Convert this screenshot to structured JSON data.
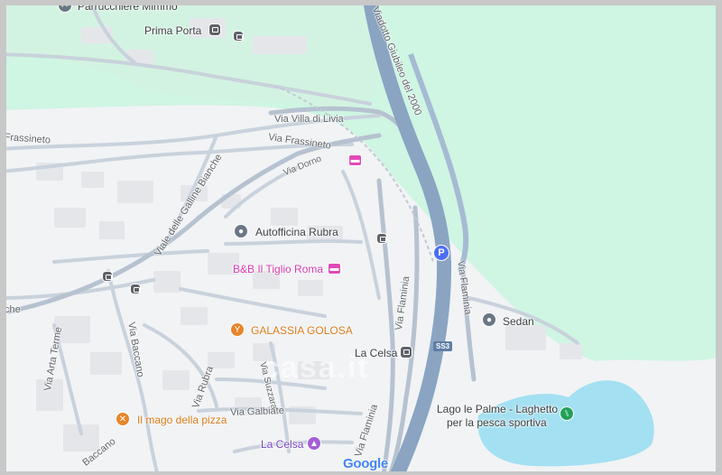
{
  "map": {
    "streets": {
      "viadotto": "Viadotto Giubileo del 2000",
      "villa_di_livia": "Via Villa di Livia",
      "frassineto": "Via Frassineto",
      "frassineto_left": "Frassineto",
      "dorno": "Via Dorno",
      "galline_bianche": "Viale delle Galline Bianche",
      "flaminia_upper": "Via Flaminia",
      "flaminia_right": "Via Flaminia",
      "flaminia_lower": "Via Flaminia",
      "baccano_upper": "Via Baccano",
      "baccano_lower": "Baccano",
      "arta_terme": "Via Arta Terme",
      "rubra": "Via Rubra",
      "suzzara": "Via Suzzara",
      "galbiate": "Via Galbiate",
      "che": "che"
    },
    "places": {
      "parrucchiere": "Parrucchiere Mimmo",
      "prima_porta": "Prima Porta",
      "autofficina": "Autofficina Rubra",
      "bnb": "B&B Il Tiglio Roma",
      "galassia": "GALASSIA GOLOSA",
      "la_celsa_station": "La Celsa",
      "sedan": "Sedan",
      "lago_line1": "Lago le Palme - Laghetto",
      "lago_line2": "per la pesca sportiva",
      "mago_pizza": "Il mago della pizza",
      "la_celsa_church": "La Celsa"
    },
    "shields": {
      "ss3": "SS3"
    },
    "parking_symbol": "P",
    "attribution": "Google",
    "watermark": "casa.it",
    "colors": {
      "park": "#cff5e3",
      "land": "#f1f3f5",
      "highway": "#8aa4c2",
      "road": "#c9d2dc",
      "water": "#a3e0f2",
      "building": "#e6e8eb"
    }
  }
}
